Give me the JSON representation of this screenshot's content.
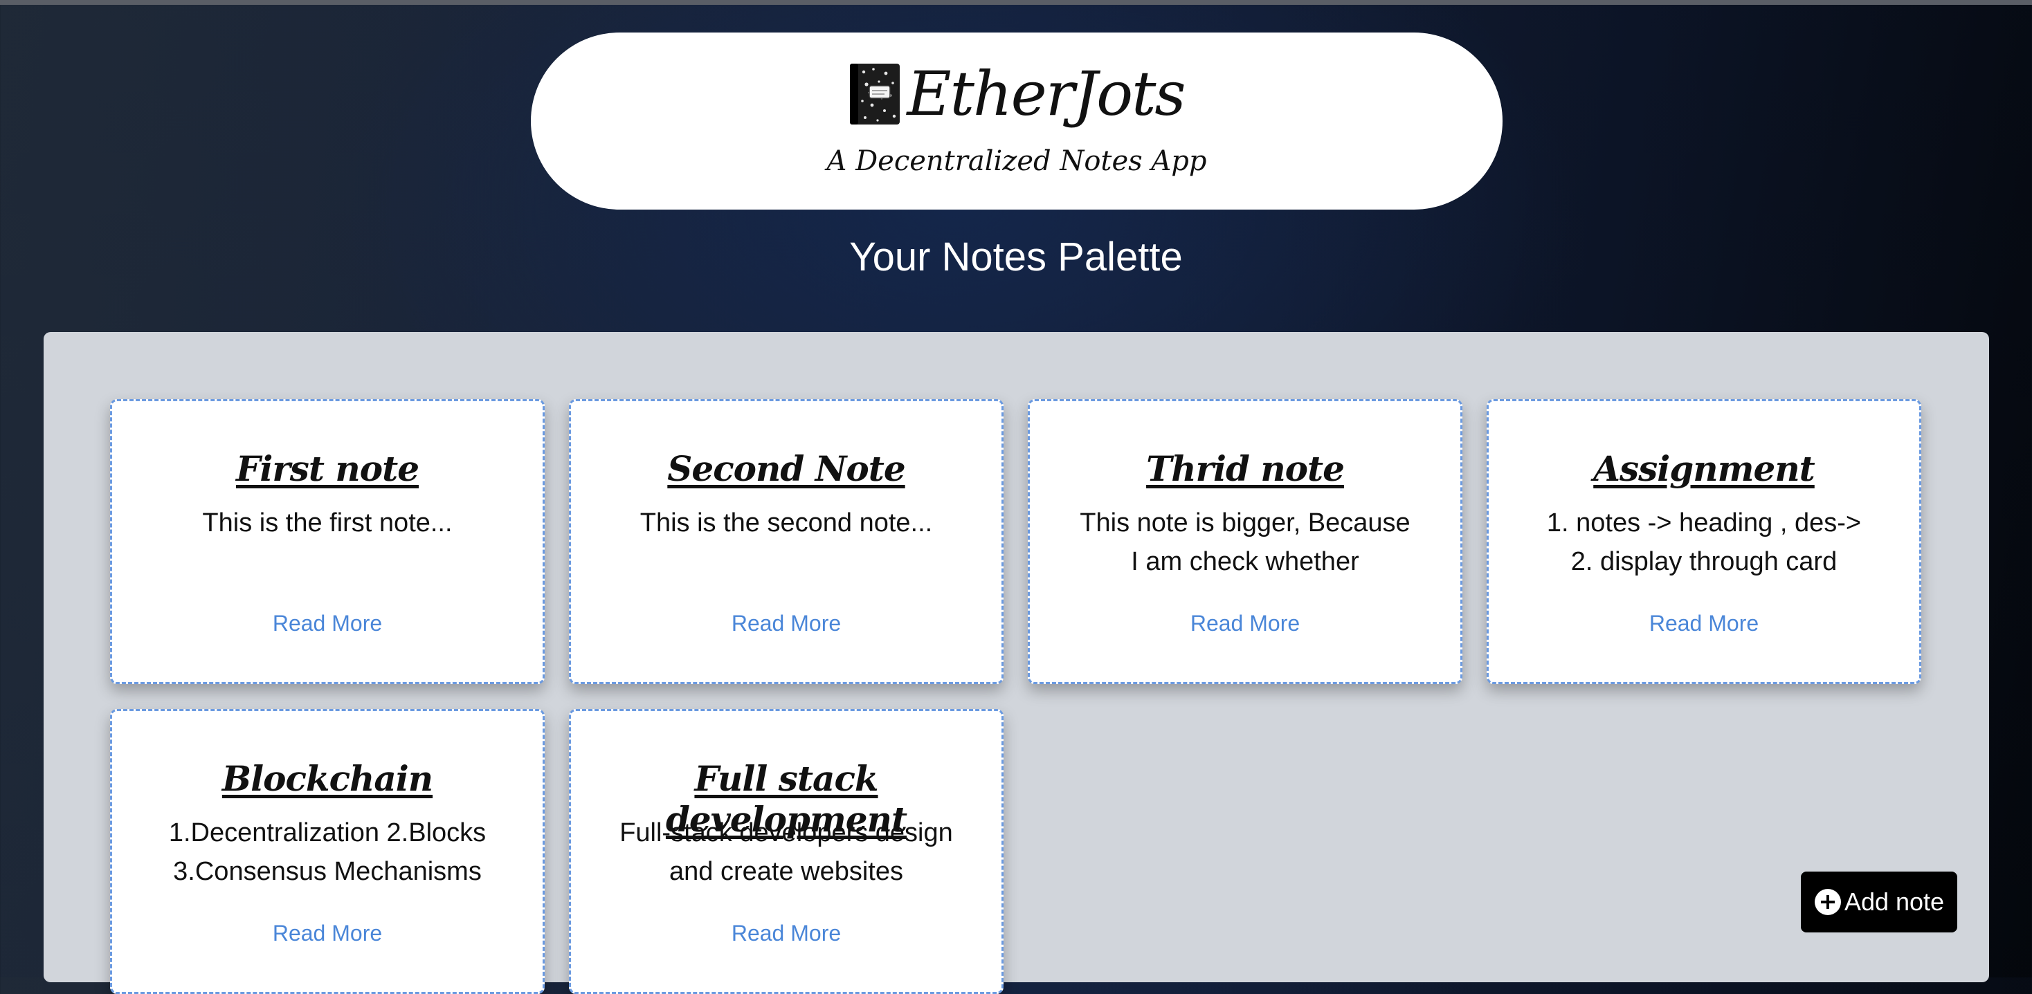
{
  "header": {
    "app_title": "EtherJots",
    "subtitle": "A Decentralized Notes App"
  },
  "main": {
    "heading": "Your Notes Palette"
  },
  "notes": [
    {
      "title": "First note",
      "body": "This is the first note...",
      "read_more": "Read More"
    },
    {
      "title": "Second Note",
      "body": "This is the second note...",
      "read_more": "Read More"
    },
    {
      "title": "Thrid note",
      "body": "This note is bigger, Because I am check whether",
      "read_more": "Read More"
    },
    {
      "title": "Assignment",
      "body": "1. notes -> heading , des-> 2. display through card",
      "read_more": "Read More"
    },
    {
      "title": "Blockchain",
      "body": "1.Decentralization 2.Blocks 3.Consensus Mechanisms",
      "read_more": "Read More"
    },
    {
      "title": "Full stack development",
      "body": "Full-stack developers design and create websites",
      "read_more": "Read More"
    }
  ],
  "actions": {
    "add_note_label": "Add note",
    "add_note_icon": "plus-circle-icon"
  },
  "colors": {
    "card_border": "#6b9ae0",
    "link": "#4a86d8",
    "board": "#d1d5db",
    "button": "#000000"
  },
  "icons": {
    "logo": "notebook-icon"
  }
}
